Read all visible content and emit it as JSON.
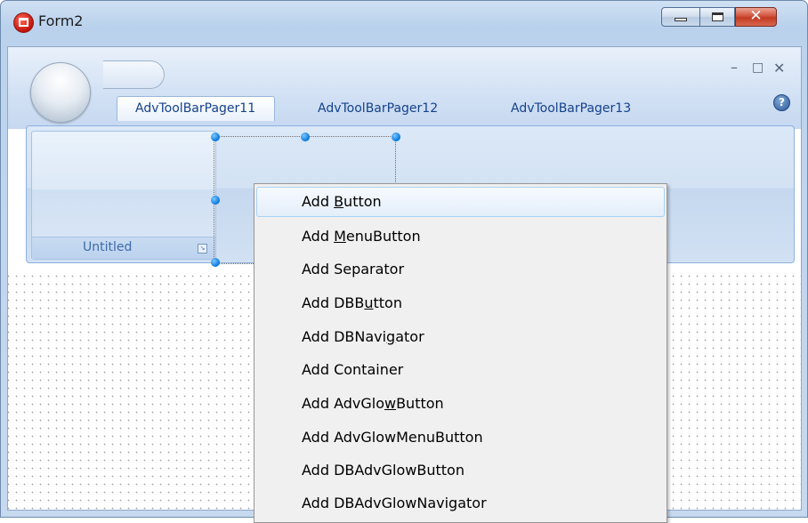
{
  "window": {
    "title": "Form2",
    "controls": {
      "minimize": "–",
      "maximize": "□",
      "close": "✕"
    }
  },
  "ribbon": {
    "caption_controls": {
      "minimize": "–",
      "maximize": "□",
      "close": "✕"
    },
    "tabs": [
      {
        "label": "AdvToolBarPager11",
        "selected": true
      },
      {
        "label": "AdvToolBarPager12",
        "selected": false
      },
      {
        "label": "AdvToolBarPager13",
        "selected": false
      }
    ],
    "help": "?",
    "group": {
      "caption": "Untitled"
    }
  },
  "context_menu": {
    "items": [
      {
        "pre": "Add ",
        "accel": "B",
        "post": "utton",
        "highlighted": true
      },
      {
        "pre": "Add ",
        "accel": "M",
        "post": "enuButton",
        "highlighted": false
      },
      {
        "pre": "Add Separator",
        "accel": "",
        "post": "",
        "highlighted": false
      },
      {
        "pre": "Add DBB",
        "accel": "u",
        "post": "tton",
        "highlighted": false
      },
      {
        "pre": "Add DBNavi",
        "accel": "g",
        "post": "ator",
        "highlighted": false
      },
      {
        "pre": "Add Container",
        "accel": "",
        "post": "",
        "highlighted": false
      },
      {
        "pre": "Add AdvGlo",
        "accel": "w",
        "post": "Button",
        "highlighted": false
      },
      {
        "pre": "Add AdvGlowMenuButton",
        "accel": "",
        "post": "",
        "highlighted": false
      },
      {
        "pre": "Add DBAdvGlowButton",
        "accel": "",
        "post": "",
        "highlighted": false
      },
      {
        "pre": "Add DBAdvGlowNavigator",
        "accel": "",
        "post": "",
        "highlighted": false
      }
    ]
  },
  "colors": {
    "menu_highlight_border": "#a8d2f4",
    "tab_text": "#15428b",
    "handle": "#0b7be0"
  }
}
